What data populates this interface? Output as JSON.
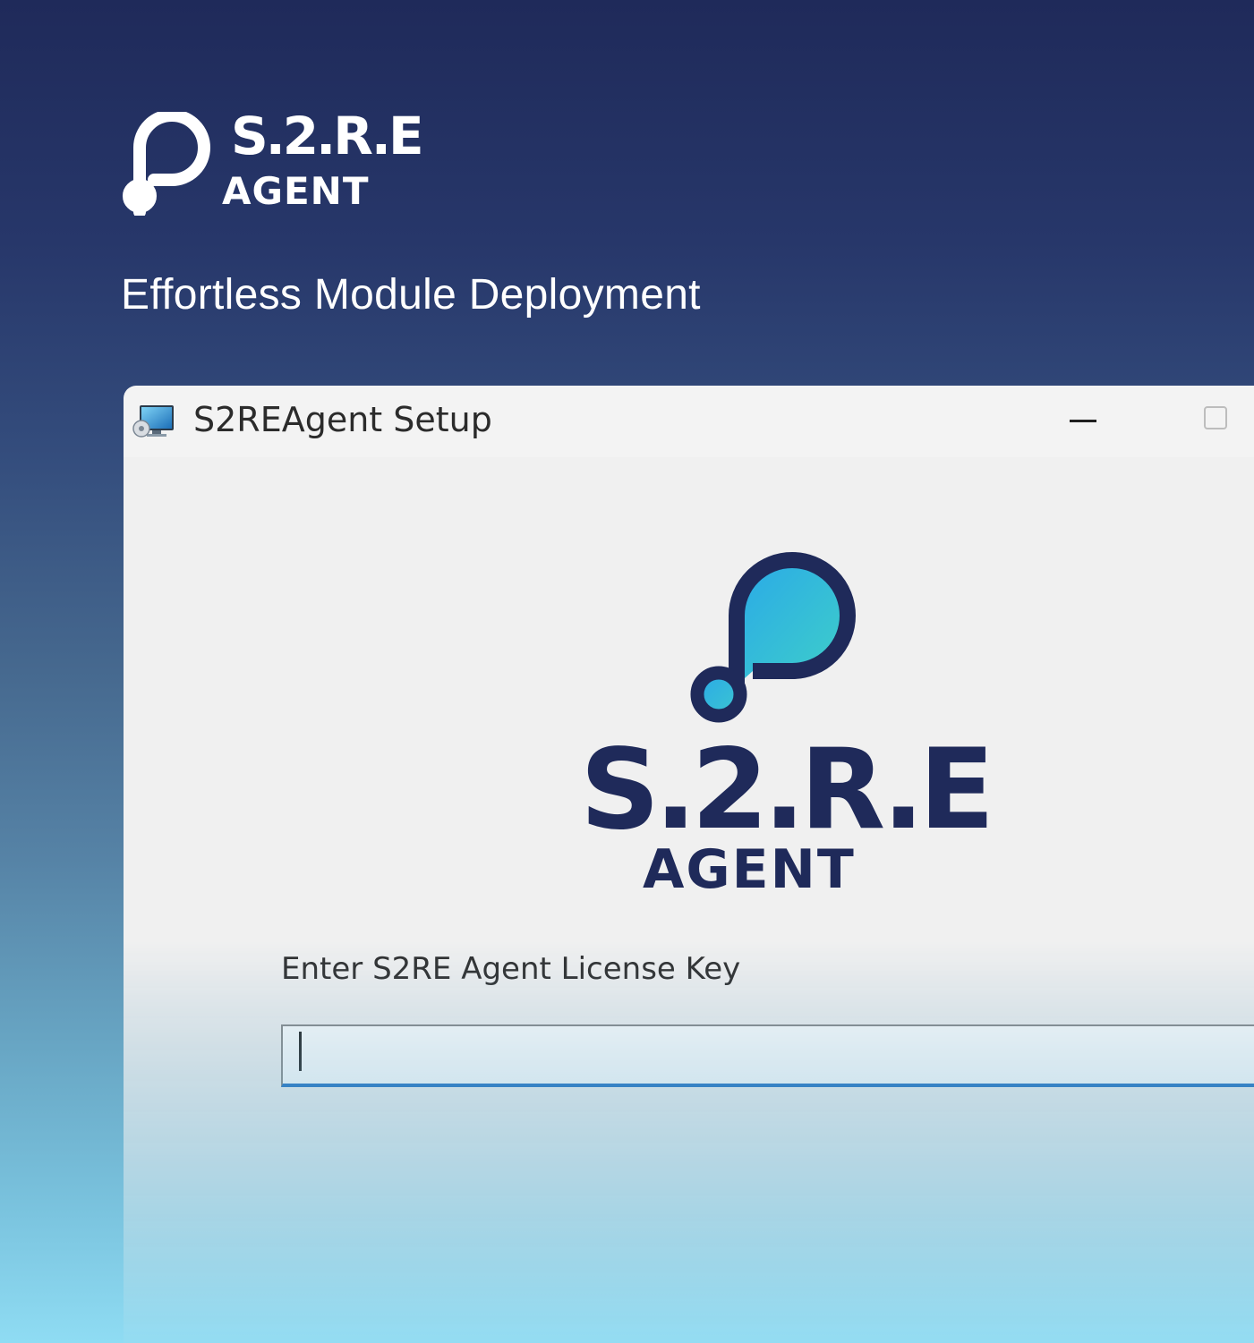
{
  "brand": {
    "name": "S.2.R.E",
    "sub": "AGENT",
    "tagline": "Effortless Module Deployment",
    "text_color": "#ffffff"
  },
  "window": {
    "title": "S2REAgent Setup",
    "app_icon": "setup-monitor-icon",
    "controls": {
      "minimize": "minimize-icon",
      "maximize": "maximize-icon"
    }
  },
  "product_logo": {
    "name": "S.2.R.E",
    "sub": "AGENT",
    "mark_icon": "s2re-loop-logo-icon",
    "navy": "#1f2a5a",
    "gradient_from": "#2fb6e6",
    "gradient_to": "#3cc6d0"
  },
  "license": {
    "label": "Enter S2RE Agent License Key",
    "value": "",
    "accent": "#1f6fc2"
  },
  "background": {
    "top": "#1f2a5a",
    "bottom": "#8fdcf3"
  }
}
